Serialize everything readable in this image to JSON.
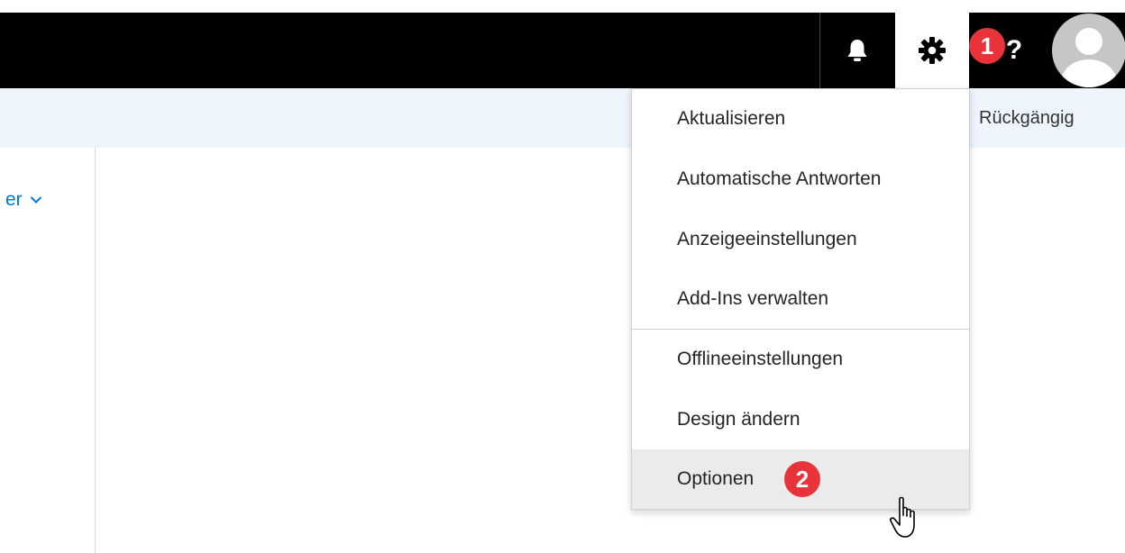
{
  "header": {
    "icons": [
      "bell-icon",
      "gear-icon",
      "help-icon",
      "avatar-icon"
    ],
    "help_label": "?",
    "badge_1": "1"
  },
  "commandbar": {
    "undo_label": "Rückgängig"
  },
  "leftpane": {
    "folder_toggle_label": "er"
  },
  "settings_menu": {
    "items": [
      {
        "label": "Aktualisieren"
      },
      {
        "label": "Automatische Antworten"
      },
      {
        "label": "Anzeigeeinstellungen"
      },
      {
        "label": "Add-Ins verwalten"
      },
      {
        "label": "Offlineeinstellungen"
      },
      {
        "label": "Design ändern"
      },
      {
        "label": "Optionen",
        "state": "hovered"
      }
    ],
    "badge_2": "2"
  },
  "colors": {
    "topbar": "#000000",
    "commandbar": "#eef5fc",
    "accent": "#0078d4",
    "badge": "#e8333b",
    "menu_hover": "#ebebeb"
  }
}
